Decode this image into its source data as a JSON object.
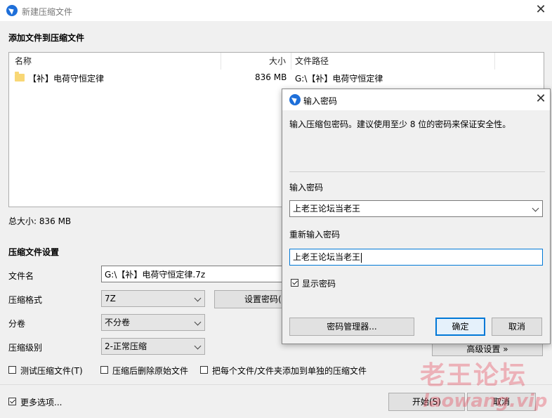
{
  "window": {
    "title": "新建压缩文件",
    "close_icon": "close-icon"
  },
  "files_section": {
    "title": "添加文件到压缩文件",
    "columns": {
      "name": "名称",
      "size": "大小",
      "path": "文件路径"
    },
    "rows": [
      {
        "name": "【补】电荷守恒定律",
        "size": "836 MB",
        "path": "G:\\【补】电荷守恒定律"
      }
    ],
    "total_size": "总大小: 836 MB"
  },
  "settings": {
    "title": "压缩文件设置",
    "filename_label": "文件名",
    "filename_value": "G:\\【补】电荷守恒定律.7z",
    "format_label": "压缩格式",
    "format_value": "7Z",
    "set_password_button": "设置密码(P)...",
    "volume_label": "分卷",
    "volume_value": "不分卷",
    "level_label": "压缩级别",
    "level_value": "2-正常压缩",
    "advanced_button": "高级设置 »",
    "test_archive": {
      "label": "测试压缩文件(T)",
      "checked": false
    },
    "delete_after": {
      "label": "压缩后删除原始文件",
      "checked": false
    },
    "separate_archives": {
      "label": "把每个文件/文件夹添加到单独的压缩文件",
      "checked": false
    }
  },
  "footer": {
    "more_options": {
      "label": "更多选项...",
      "checked": true
    },
    "start_button": "开始(S)",
    "cancel_button": "取消"
  },
  "password_dialog": {
    "title": "输入密码",
    "hint": "输入压缩包密码。建议使用至少 8 位的密码来保证安全性。",
    "password_label": "输入密码",
    "password_value": "上老王论坛当老王",
    "confirm_label": "重新输入密码",
    "confirm_value": "上老王论坛当老王",
    "show_password": {
      "label": "显示密码",
      "checked": true
    },
    "manager_button": "密码管理器...",
    "ok_button": "确定",
    "cancel_button": "取消"
  },
  "watermark": {
    "cn": "老王论坛",
    "en": "laowang.vip"
  },
  "colors": {
    "accent": "#0078d7",
    "folder": "#f8d775",
    "watermark": "#e63c50"
  }
}
